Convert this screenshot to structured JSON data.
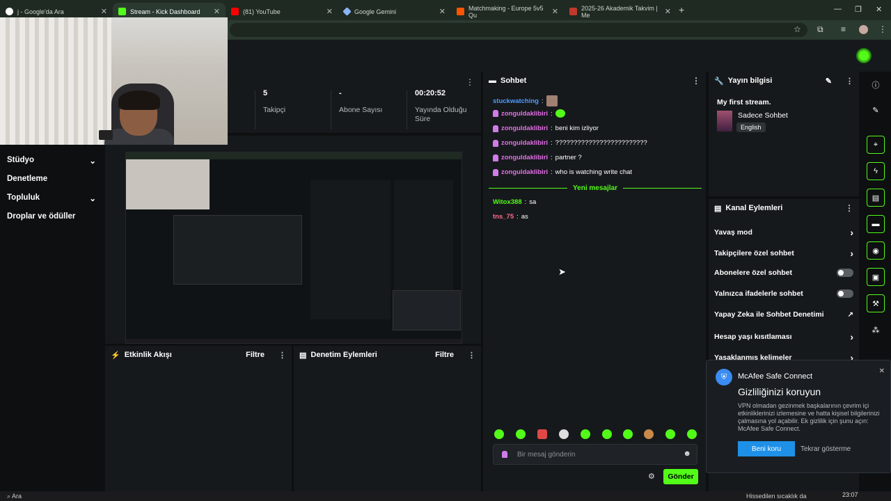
{
  "browser": {
    "tabs": [
      {
        "title": "j - Google'da Ara",
        "color": "#ffffff"
      },
      {
        "title": "Stream - Kick Dashboard",
        "color": "#53fc18"
      },
      {
        "title": "(81) YouTube",
        "color": "#ff0000"
      },
      {
        "title": "Google Gemini",
        "color": "#8ab4f8"
      },
      {
        "title": "Matchmaking - Europe 5v5 Qu",
        "color": "#ff5500"
      },
      {
        "title": "2025-26 Akademik Takvim | Me",
        "color": "#c0392b"
      }
    ]
  },
  "nav": {
    "items": [
      {
        "label": "Stüdyo",
        "chevron": "⌄"
      },
      {
        "label": "Denetleme",
        "chevron": ""
      },
      {
        "label": "Topluluk",
        "chevron": "⌄"
      },
      {
        "label": "Droplar ve ödüller",
        "chevron": ""
      }
    ]
  },
  "stats": [
    {
      "value": "5",
      "label": "Takipçi"
    },
    {
      "value": "-",
      "label": "Abone Sayısı"
    },
    {
      "value": "00:20:52",
      "label": "Yayında Olduğu Süre"
    }
  ],
  "panels": {
    "activity": {
      "title": "Etkinlik Akışı",
      "filter": "Filtre"
    },
    "moderation": {
      "title": "Denetim Eylemleri",
      "filter": "Filtre"
    }
  },
  "chat": {
    "title": "Sohbet",
    "messages": [
      {
        "user": "stuckwatching",
        "text": "",
        "color": "#4e9bff",
        "badge": false
      },
      {
        "user": "zonguldaklibiri",
        "text": "",
        "color": "#e46fe8",
        "badge": true
      },
      {
        "user": "zonguldaklibiri",
        "text": "beni kim izliyor",
        "color": "#e46fe8",
        "badge": true
      },
      {
        "user": "zonguldaklibiri",
        "text": "?????????????????????????",
        "color": "#e46fe8",
        "badge": true
      },
      {
        "user": "zonguldaklibiri",
        "text": "partner ?",
        "color": "#e46fe8",
        "badge": true
      },
      {
        "user": "zonguldaklibiri",
        "text": "who is watching write chat",
        "color": "#e46fe8",
        "badge": true
      }
    ],
    "divider": "Yeni mesajlar",
    "new_messages": [
      {
        "user": "Witox388",
        "text": "sa",
        "color": "#53fc18"
      },
      {
        "user": "tns_75",
        "text": "as",
        "color": "#ff6b8a"
      }
    ],
    "input_placeholder": "Bir mesaj gönderin",
    "send_label": "Gönder"
  },
  "stream_info": {
    "title": "Yayın bilgisi",
    "stream_title": "My first stream.",
    "category": "Sadece Sohbet",
    "language": "English"
  },
  "channel_actions": {
    "title": "Kanal Eylemleri",
    "items": [
      {
        "label": "Yavaş mod",
        "control": "chevron"
      },
      {
        "label": "Takipçilere özel sohbet",
        "control": "chevron"
      },
      {
        "label": "Abonelere özel sohbet",
        "control": "toggle"
      },
      {
        "label": "Yalnızca ifadelerle sohbet",
        "control": "toggle"
      },
      {
        "label": "Yapay Zeka ile Sohbet Denetimi",
        "control": "external"
      },
      {
        "label": "Hesap yaşı kısıtlaması",
        "control": "chevron"
      },
      {
        "label": "Yasaklanmış kelimeler",
        "control": "chevron"
      }
    ]
  },
  "mcafee": {
    "brand": "McAfee Safe Connect",
    "heading": "Gizliliğinizi koruyun",
    "body": "VPN olmadan gezinmek başkalarının çevrim içi etkinliklerinizi izlemesine ve hatta kişisel bilgilerinizi çalmasına yol açabilir. Ek gizlilik için şunu açın: McAfee Safe Connect.",
    "primary": "Beni koru",
    "secondary": "Tekrar gösterme"
  },
  "taskbar": {
    "search": "Ara",
    "time": "23:07",
    "weather": "Hissedilen sıcaklık da"
  }
}
